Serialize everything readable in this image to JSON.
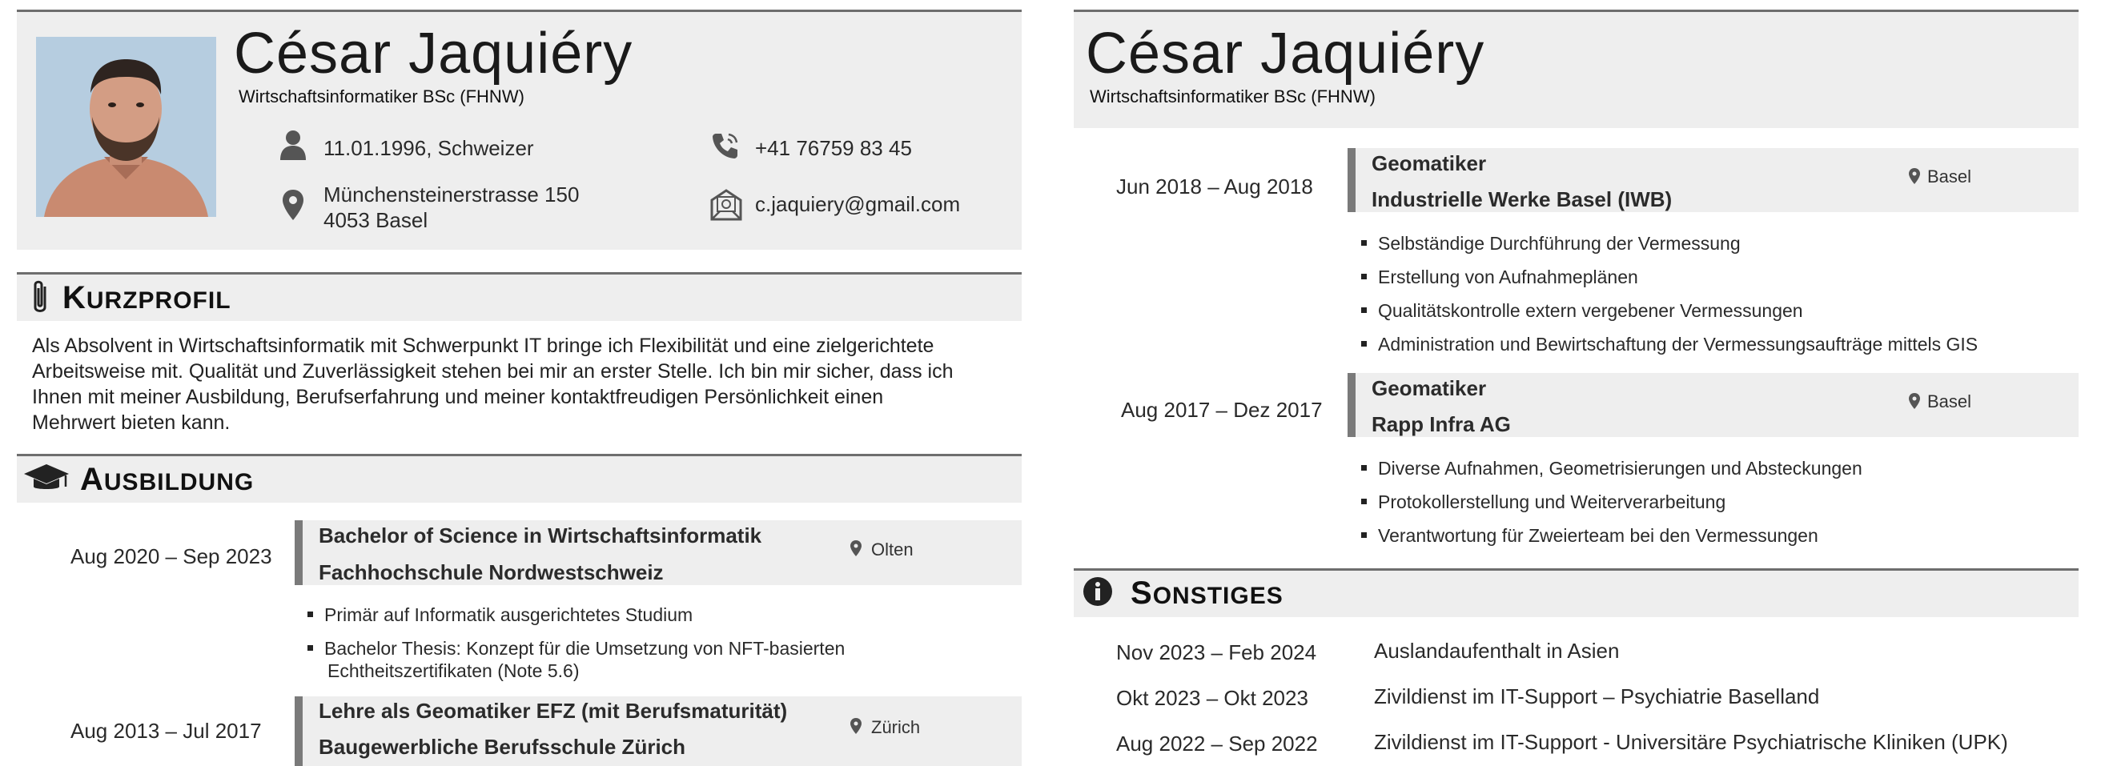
{
  "left": {
    "header": {
      "name": "César Jaquiéry",
      "subtitle": "Wirtschaftsinformatiker BSc (FHNW)",
      "birth": "11.01.1996, Schweizer",
      "phone": "+41 76759 83 45",
      "street": "Münchensteinerstrasse 150",
      "city": "4053 Basel",
      "email": "c.jaquiery@gmail.com"
    },
    "kurzprofil": {
      "title_first": "K",
      "title_rest": "URZPROFIL",
      "lines": [
        "Als Absolvent in Wirtschaftsinformatik mit Schwerpunkt IT bringe ich Flexibilität und eine zielgerichtete",
        "Arbeitsweise mit. Qualität und Zuverlässigkeit stehen bei mir an erster Stelle. Ich bin mir sicher, dass ich",
        "Ihnen mit meiner Ausbildung, Berufserfahrung und meiner kontaktfreudigen Persönlichkeit einen",
        "Mehrwert bieten kann."
      ]
    },
    "ausbildung": {
      "title_first": "A",
      "title_rest": "USBILDUNG",
      "entries": [
        {
          "date": "Aug 2020 – Sep 2023",
          "line1": "Bachelor of Science in Wirtschaftsinformatik",
          "line2": "Fachhochschule Nordwestschweiz",
          "location": "Olten",
          "bullets": [
            "Primär auf Informatik ausgerichtetes Studium",
            "Bachelor Thesis: Konzept für die Umsetzung von NFT-basierten",
            "Echtheitszertifikaten (Note 5.6)"
          ]
        },
        {
          "date": "Aug 2013 – Jul 2017",
          "line1": "Lehre als Geomatiker EFZ (mit Berufsmaturität)",
          "line2": "Baugewerbliche Berufsschule Zürich",
          "location": "Zürich"
        }
      ]
    }
  },
  "right": {
    "header": {
      "name": "César Jaquiéry",
      "subtitle": "Wirtschaftsinformatiker BSc (FHNW)"
    },
    "experience": [
      {
        "date": "Jun 2018 – Aug 2018",
        "title": "Geomatiker",
        "company": "Industrielle Werke Basel (IWB)",
        "location": "Basel",
        "bullets": [
          "Selbständige Durchführung der Vermessung",
          "Erstellung von Aufnahmeplänen",
          "Qualitätskontrolle extern vergebener Vermessungen",
          "Administration und Bewirtschaftung der Vermessungsaufträge mittels GIS"
        ]
      },
      {
        "date": "Aug 2017 – Dez 2017",
        "title": "Geomatiker",
        "company": "Rapp Infra AG",
        "location": "Basel",
        "bullets": [
          "Diverse Aufnahmen, Geometrisierungen und Absteckungen",
          "Protokollerstellung und Weiterverarbeitung",
          "Verantwortung für Zweierteam bei den Vermessungen"
        ]
      }
    ],
    "sonstiges": {
      "title_first": "S",
      "title_rest": "ONSTIGES",
      "items": [
        {
          "date": "Nov 2023 – Feb 2024",
          "text": "Auslandaufenthalt in Asien"
        },
        {
          "date": "Okt 2023 – Okt 2023",
          "text": "Zivildienst im IT-Support – Psychiatrie Baselland"
        },
        {
          "date": "Aug 2022 – Sep 2022",
          "text": "Zivildienst im IT-Support - Universitäre Psychiatrische Kliniken (UPK)"
        }
      ]
    }
  },
  "colors": {
    "panel": "#eeeeee",
    "rule": "#6e6e6e",
    "accent_bar": "#7a7a7a"
  },
  "icons": [
    "person-icon",
    "phone-icon",
    "location-pin-icon",
    "email-icon",
    "paperclip-icon",
    "graduation-cap-icon",
    "info-icon"
  ]
}
